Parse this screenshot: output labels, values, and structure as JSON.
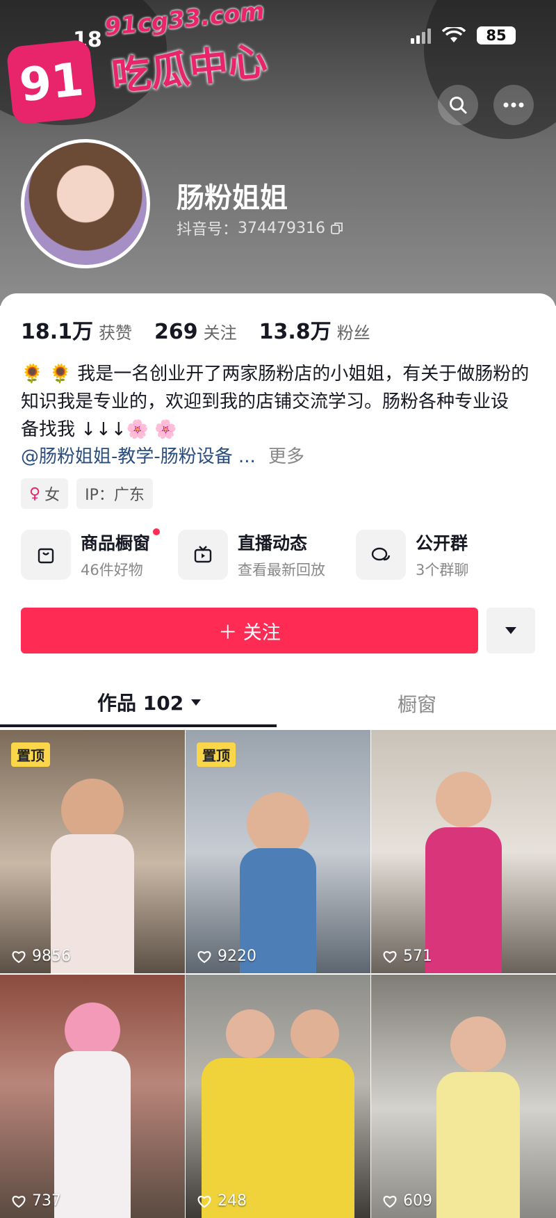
{
  "status_bar": {
    "time": "18",
    "battery": "85"
  },
  "watermark": {
    "badge": "91",
    "url": "91cg33.com",
    "name": "吃瓜中心"
  },
  "profile": {
    "nickname": "肠粉姐姐",
    "id_label": "抖音号：",
    "id_value": "374479316"
  },
  "stats": [
    {
      "value": "18.1万",
      "label": "获赞"
    },
    {
      "value": "269",
      "label": "关注"
    },
    {
      "value": "13.8万",
      "label": "粉丝"
    }
  ],
  "bio": {
    "line1": "🌻 🌻 我是一名创业开了两家肠粉店的小姐姐，有关于做肠粉的",
    "line2": "知识我是专业的，欢迎到我的店铺交流学习。肠粉各种专业设",
    "line3": "备找我 ↓↓↓🌸 🌸",
    "link": "@肠粉姐姐-教学-肠粉设备 ...",
    "more": "更多"
  },
  "tags": {
    "gender_symbol": "♀",
    "gender": "女",
    "ip": "IP：广东"
  },
  "features": [
    {
      "title": "商品橱窗",
      "subtitle": "46件好物",
      "icon": "bag-icon"
    },
    {
      "title": "直播动态",
      "subtitle": "查看最新回放",
      "icon": "tv-icon"
    },
    {
      "title": "公开群",
      "subtitle": "3个群聊",
      "icon": "chat-icon"
    }
  ],
  "follow_label": "＋ 关注",
  "tabs": {
    "works_label": "作品 102",
    "shop_label": "橱窗"
  },
  "pinned_label": "置顶",
  "videos": [
    {
      "likes": "9856",
      "pinned": true
    },
    {
      "likes": "9220",
      "pinned": true
    },
    {
      "likes": "571",
      "pinned": false
    },
    {
      "likes": "737",
      "pinned": false
    },
    {
      "likes": "248",
      "pinned": false
    },
    {
      "likes": "609",
      "pinned": false
    }
  ],
  "colors": {
    "accent": "#fe2c55",
    "link": "#2a4d7d",
    "watermark": "#e8256b",
    "pin": "#f9d64a"
  }
}
